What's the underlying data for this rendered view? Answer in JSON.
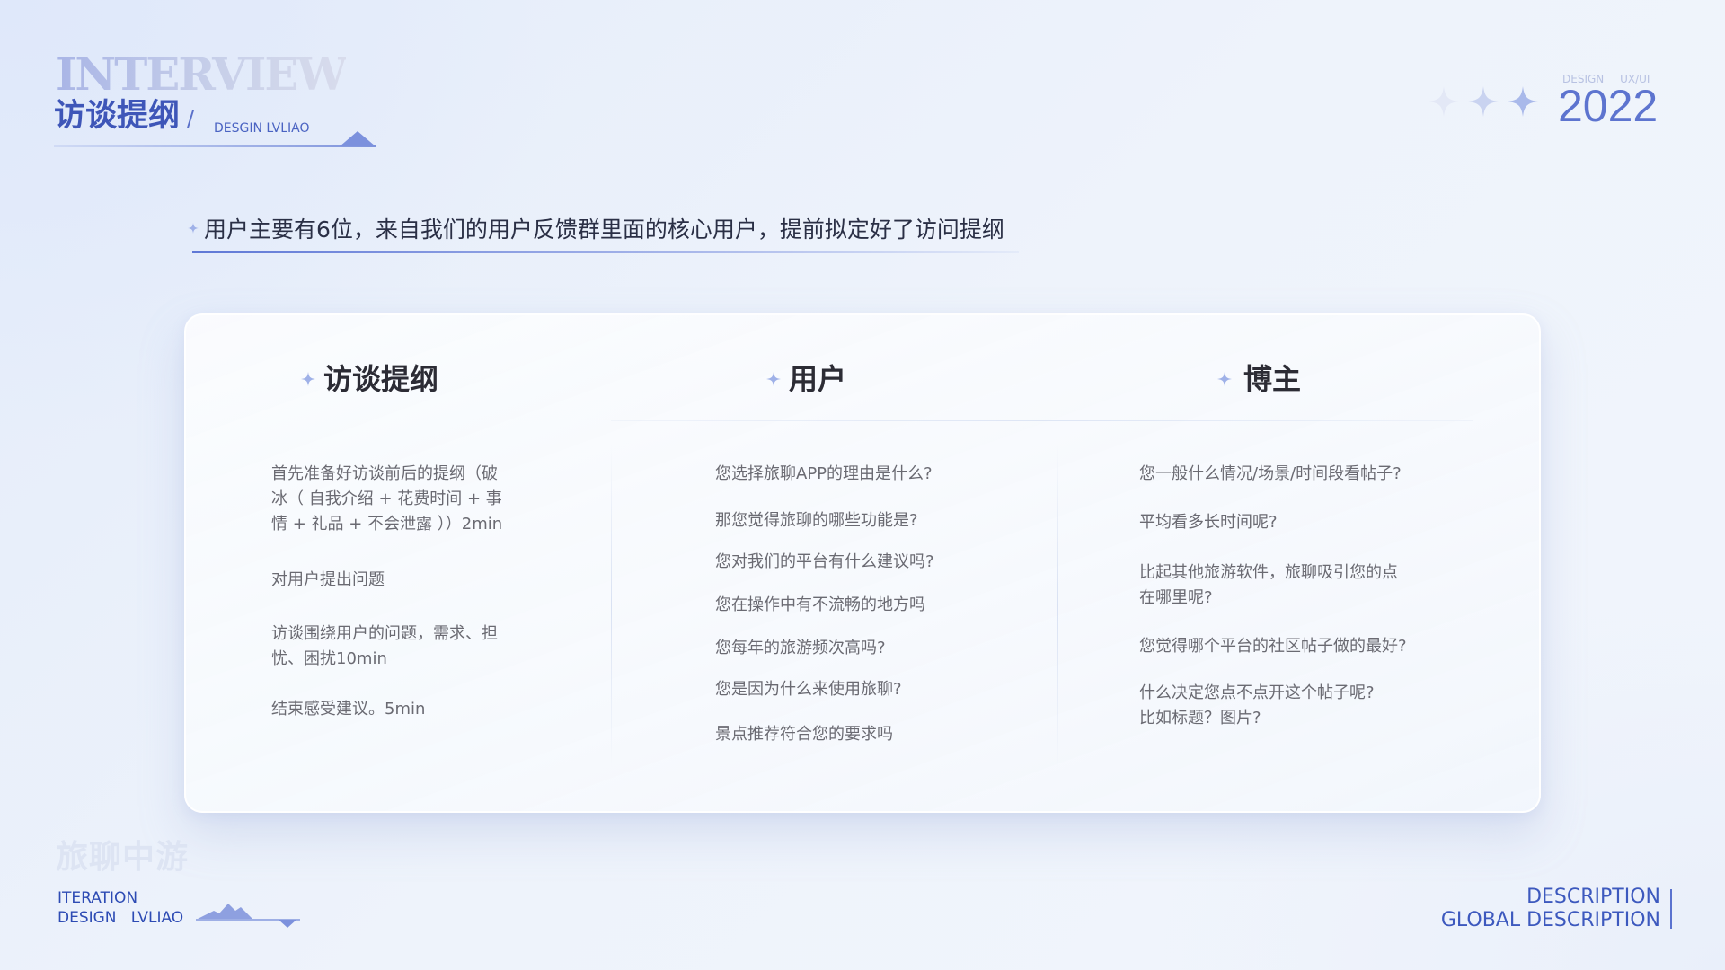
{
  "header": {
    "title_en": "INTERVIEW",
    "title_cn": "访谈提纲",
    "slash": "/",
    "subtitle": "DESGIN LVLIAO",
    "meta_left": "DESIGN",
    "meta_right": "UX/UI",
    "year": "2022"
  },
  "intro": {
    "text": "用户主要有6位，来自我们的用户反馈群里面的核心用户，提前拟定好了访问提纲"
  },
  "columns": [
    {
      "title": "访谈提纲",
      "items": [
        [
          "首先准备好访谈前后的提纲（破",
          "冰（ 自我介绍 + 花费时间 + 事",
          "情 + 礼品 + 不会泄露 ））2min"
        ],
        [
          "对用户提出问题"
        ],
        [
          "访谈围绕用户的问题，需求、担",
          "忧、困扰10min"
        ],
        [
          "结束感受建议。5min"
        ]
      ]
    },
    {
      "title": "用户",
      "items": [
        [
          "您选择旅聊APP的理由是什么?"
        ],
        [
          "那您觉得旅聊的哪些功能是?"
        ],
        [
          "您对我们的平台有什么建议吗?"
        ],
        [
          "您在操作中有不流畅的地方吗"
        ],
        [
          "您每年的旅游频次高吗?"
        ],
        [
          "您是因为什么来使用旅聊?"
        ],
        [
          "景点推荐符合您的要求吗"
        ]
      ]
    },
    {
      "title": "博主",
      "items": [
        [
          "您一般什么情况/场景/时间段看帖子?"
        ],
        [
          "平均看多长时间呢?"
        ],
        [
          "比起其他旅游软件，旅聊吸引您的点",
          "在哪里呢?"
        ],
        [
          "您觉得哪个平台的社区帖子做的最好?"
        ],
        [
          "什么决定您点不点开这个帖子呢?",
          "比如标题？图片?"
        ]
      ]
    }
  ],
  "footer": {
    "brand_cn": "旅聊中游",
    "line1": "ITERATION",
    "line2": "DESIGN   LVLIAO",
    "desc1": "DESCRIPTION",
    "desc2": "GLOBAL DESCRIPTION"
  },
  "colors": {
    "accent": "#3e56b8",
    "accent_light": "#7c91dd",
    "text_dark": "#2a2f45",
    "text_body": "#6a6a72"
  }
}
